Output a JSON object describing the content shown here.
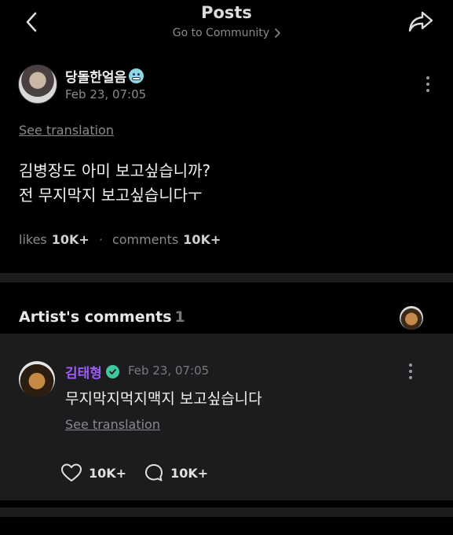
{
  "header": {
    "title": "Posts",
    "subtitle": "Go to Community",
    "back_icon": "chevron-left-icon",
    "share_icon": "share-arrow-icon"
  },
  "post": {
    "author": "당돌한얼음",
    "author_emoji": "cold-face-emoji",
    "date": "Feb 23, 07:05",
    "see_translation": "See translation",
    "body_lines": [
      "김병장도 아미 보고싶습니까?",
      "전 무지막지 보고싶습니다ㅜ"
    ],
    "stats": {
      "likes_label": "likes",
      "likes_value": "10K+",
      "separator": "·",
      "comments_label": "comments",
      "comments_value": "10K+"
    }
  },
  "artist_comments": {
    "title": "Artist's comments",
    "count": "1",
    "comment": {
      "author": "김태형",
      "verified_icon": "verified-check-icon",
      "date": "Feb 23, 07:05",
      "body": "무지막지먹지맥지 보고싶습니다",
      "see_translation": "See translation",
      "likes": "10K+",
      "replies": "10K+"
    }
  },
  "colors": {
    "background": "#000000",
    "card": "#1c1c1e",
    "muted_text": "#8a8a8e",
    "artist_name": "#9d5cf5",
    "verified": "#3fc8a0"
  }
}
